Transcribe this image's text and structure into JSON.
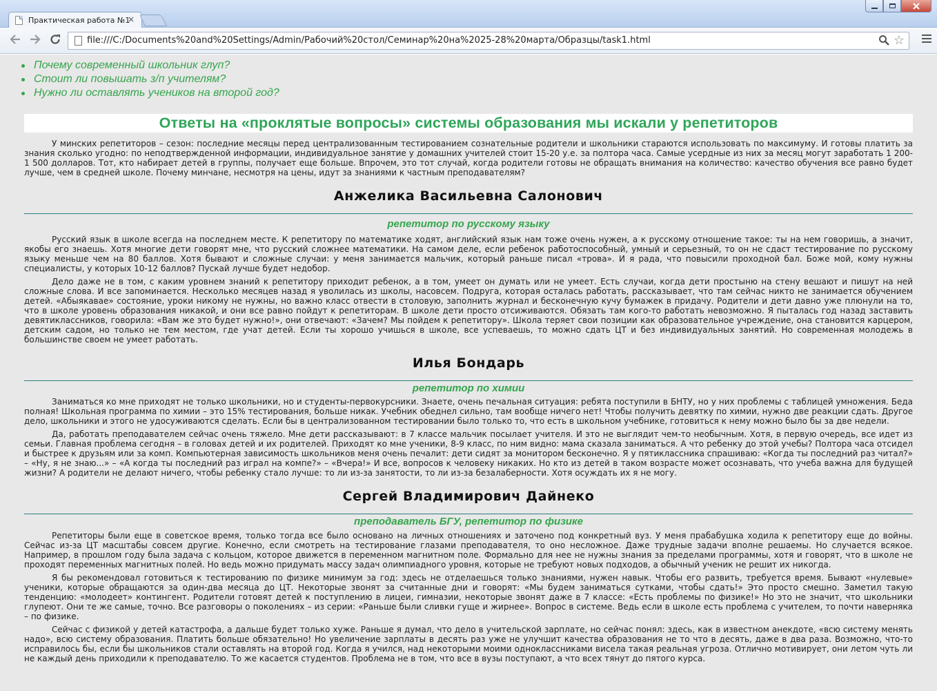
{
  "browser": {
    "tab_title": "Практическая работа №1",
    "tab_close": "×",
    "url": "file:///C:/Documents%20and%20Settings/Admin/Рабочий%20стол/Семинар%20на%2025-28%20марта/Образцы/task1.html"
  },
  "questions": [
    "Почему современный школьник глуп?",
    "Стоит ли повышать з/п учителям?",
    "Нужно ли оставлять учеников на второй год?"
  ],
  "headline": "Ответы на «проклятые вопросы» системы образования мы искали у репетиторов",
  "intro": "У минских репетиторов – сезон: последние месяцы перед централизованным тестированием сознательные родители и школьники стараются использовать по максимуму. И готовы платить за знания сколько угодно: по неподтвержденной информации, индивидуальное занятие у домашних учителей стоит 15-20 у.е. за полтора часа. Самые усердные из них за месяц могут заработать 1 200-1 500 долларов. Тот, кто набирает детей в группы, получает еще больше. Впрочем, это тот случай, когда родители готовы не обращать внимания на количество: качество обучения все равно будет лучше, чем в средней школе. Почему минчане, несмотря на цены, идут за знаниями к частным преподавателям?",
  "tutors": [
    {
      "name": "Анжелика Васильевна Салонович",
      "role": "репетитор по русскому языку",
      "paragraphs": [
        "Русский язык в школе всегда на последнем месте. К репетитору по математике ходят, английский язык нам тоже очень нужен, а к русскому отношение такое: ты на нем говоришь, а значит, якобы его знаешь. Хотя многие дети говорят мне, что русский сложнее математики. На самом деле, если ребенок работоспособный, умный и серьезный, то он не сдаст тестирование по русскому языку меньше чем на 80 баллов. Хотя бывают и сложные случаи: у меня занимается мальчик, который раньше писал «трова». И я рада, что повысили проходной бал. Боже мой, кому нужны специалисты, у которых 10-12 баллов? Пускай лучше будет недобор.",
        "Дело даже не в том, с каким уровнем знаний к репетитору приходит ребенок, а в том, умеет он думать или не умеет. Есть случаи, когда дети простыню на стену вешают и пишут на ней сложные слова. И все запоминается. Несколько месяцев назад я уволилась из школы, насовсем. Подруга, которая осталась работать, рассказывает, что там сейчас никто не занимается обучением детей. «Абыякавае» состояние, уроки никому не нужны, но важно класс отвести в столовую, заполнить журнал и бесконечную кучу бумажек в придачу. Родители и дети давно уже плюнули на то, что в школе уровень образования никакой, и они все равно пойдут к репетиторам. В школе дети просто отсиживаются. Обязать там кого-то работать невозможно. Я пыталась год назад заставить девятиклассников, говорила: «Вам же это будет нужно!», они отвечают: «Зачем? Мы пойдем к репетитору». Школа теряет свои позиции как образовательное учреждение, она становится карцером, детским садом, но только не тем местом, где учат детей. Если ты хорошо учишься в школе, все успеваешь, то можно сдать ЦТ и без индивидуальных занятий. Но современная молодежь в большинстве своем не умеет работать."
      ]
    },
    {
      "name": "Илья Бондарь",
      "role": "репетитор по химии",
      "paragraphs": [
        "Заниматься ко мне приходят не только школьники, но и студенты-первокурсники. Знаете, очень печальная ситуация: ребята поступили в БНТУ, но у них проблемы с таблицей умножения. Беда полная! Школьная программа по химии – это 15% тестирования, больше никак. Учебник обеднел сильно, там вообще ничего нет! Чтобы получить девятку по химии, нужно две реакции сдать. Другое дело, школьники и этого не удосуживаются сделать. Если бы в централизованном тестировании было только то, что есть в школьном учебнике, готовиться к нему можно было бы за две недели.",
        "Да, работать преподавателем сейчас очень тяжело. Мне дети рассказывают: в 7 классе мальчик посылает учителя. И это не выглядит чем-то необычным. Хотя, в первую очередь, все идет из семьи. Главная проблема сегодня – в головах детей и их родителей. Приходят ко мне ученики, 8-9 класс, по ним видно: мама сказала заниматься. А что ребенку до этой учебы? Полтора часа отсидел и быстрее к друзьям или за комп. Компьютерная зависимость школьников меня очень печалит: дети сидят за монитором бесконечно. Я у пятиклассника спрашиваю: «Когда ты последний раз читал?» – «Ну, я не знаю...» – «А когда ты последний раз играл на компе?» – «Вчера!» И все, вопросов к человеку никаких. Но кто из детей в таком возрасте может осознавать, что учеба важна для будущей жизни? А родители не делают ничего, чтобы ребенку стало лучше: то ли из-за занятости, то ли из-за безалаберности. Хотя осуждать их я не могу."
      ]
    },
    {
      "name": "Сергей Владимирович Дайнеко",
      "role": "преподаватель БГУ, репетитор по физике",
      "paragraphs": [
        "Репетиторы были еще в советское время, только тогда все было основано на личных отношениях и заточено под конкретный вуз. У меня прабабушка ходила к репетитору еще до войны. Сейчас из-за ЦТ масштабы совсем другие. Конечно, если смотреть на тестирование глазами преподавателя, то оно несложное. Даже трудные задачи вполне решаемы. Но случается всякое. Например, в прошлом году была задача с кольцом, которое движется в переменном магнитном поле. Формально для нее не нужны знания за пределами программы, хотя и говорят, что в школе не проходят переменных магнитных полей. Но ведь можно придумать массу задач олимпиадного уровня, которые не требуют новых подходов, а обычный ученик не решит их никогда.",
        "Я бы рекомендовал готовиться к тестированию по физике минимум за год: здесь не отделаешься только знаниями, нужен навык. Чтобы его развить, требуется время. Бывают «нулевые» ученики, которые обращаются за один-два месяца до ЦТ. Некоторые звонят за считанные дни и говорят: «Мы будем заниматься сутками, чтобы сдать!» Это просто смешно. Заметил такую тенденцию: «молодеет» контингент. Родители готовят детей к поступлению в лицеи, гимназии, некоторые звонят даже в 7 классе: «Есть проблемы по физике!» Но это не значит, что школьники глупеют. Они те же самые, точно. Все разговоры о поколениях – из серии: «Раньше были сливки гуще и жирнее». Вопрос в системе. Ведь если в школе есть проблема с учителем, то почти наверняка – по физике.",
        "Сейчас с физикой у детей катастрофа, а дальше будет только хуже. Раньше я думал, что дело в учительской зарплате, но сейчас понял: здесь, как в известном анекдоте, «всю систему менять надо», всю систему образования. Платить больше обязательно! Но увеличение зарплаты в десять раз уже не улучшит качества образования не то что в десять, даже в два раза. Возможно, что-то исправилось бы, если бы школьников стали оставлять на второй год. Когда я учился, над некоторыми моими одноклассниками висела такая реальная угроза. Отлично мотивирует, они летом чуть ли не каждый день приходили к преподавателю. То же касается студентов. Проблема не в том, что все в вузы поступают, а что всех тянут до пятого курса."
      ]
    }
  ]
}
